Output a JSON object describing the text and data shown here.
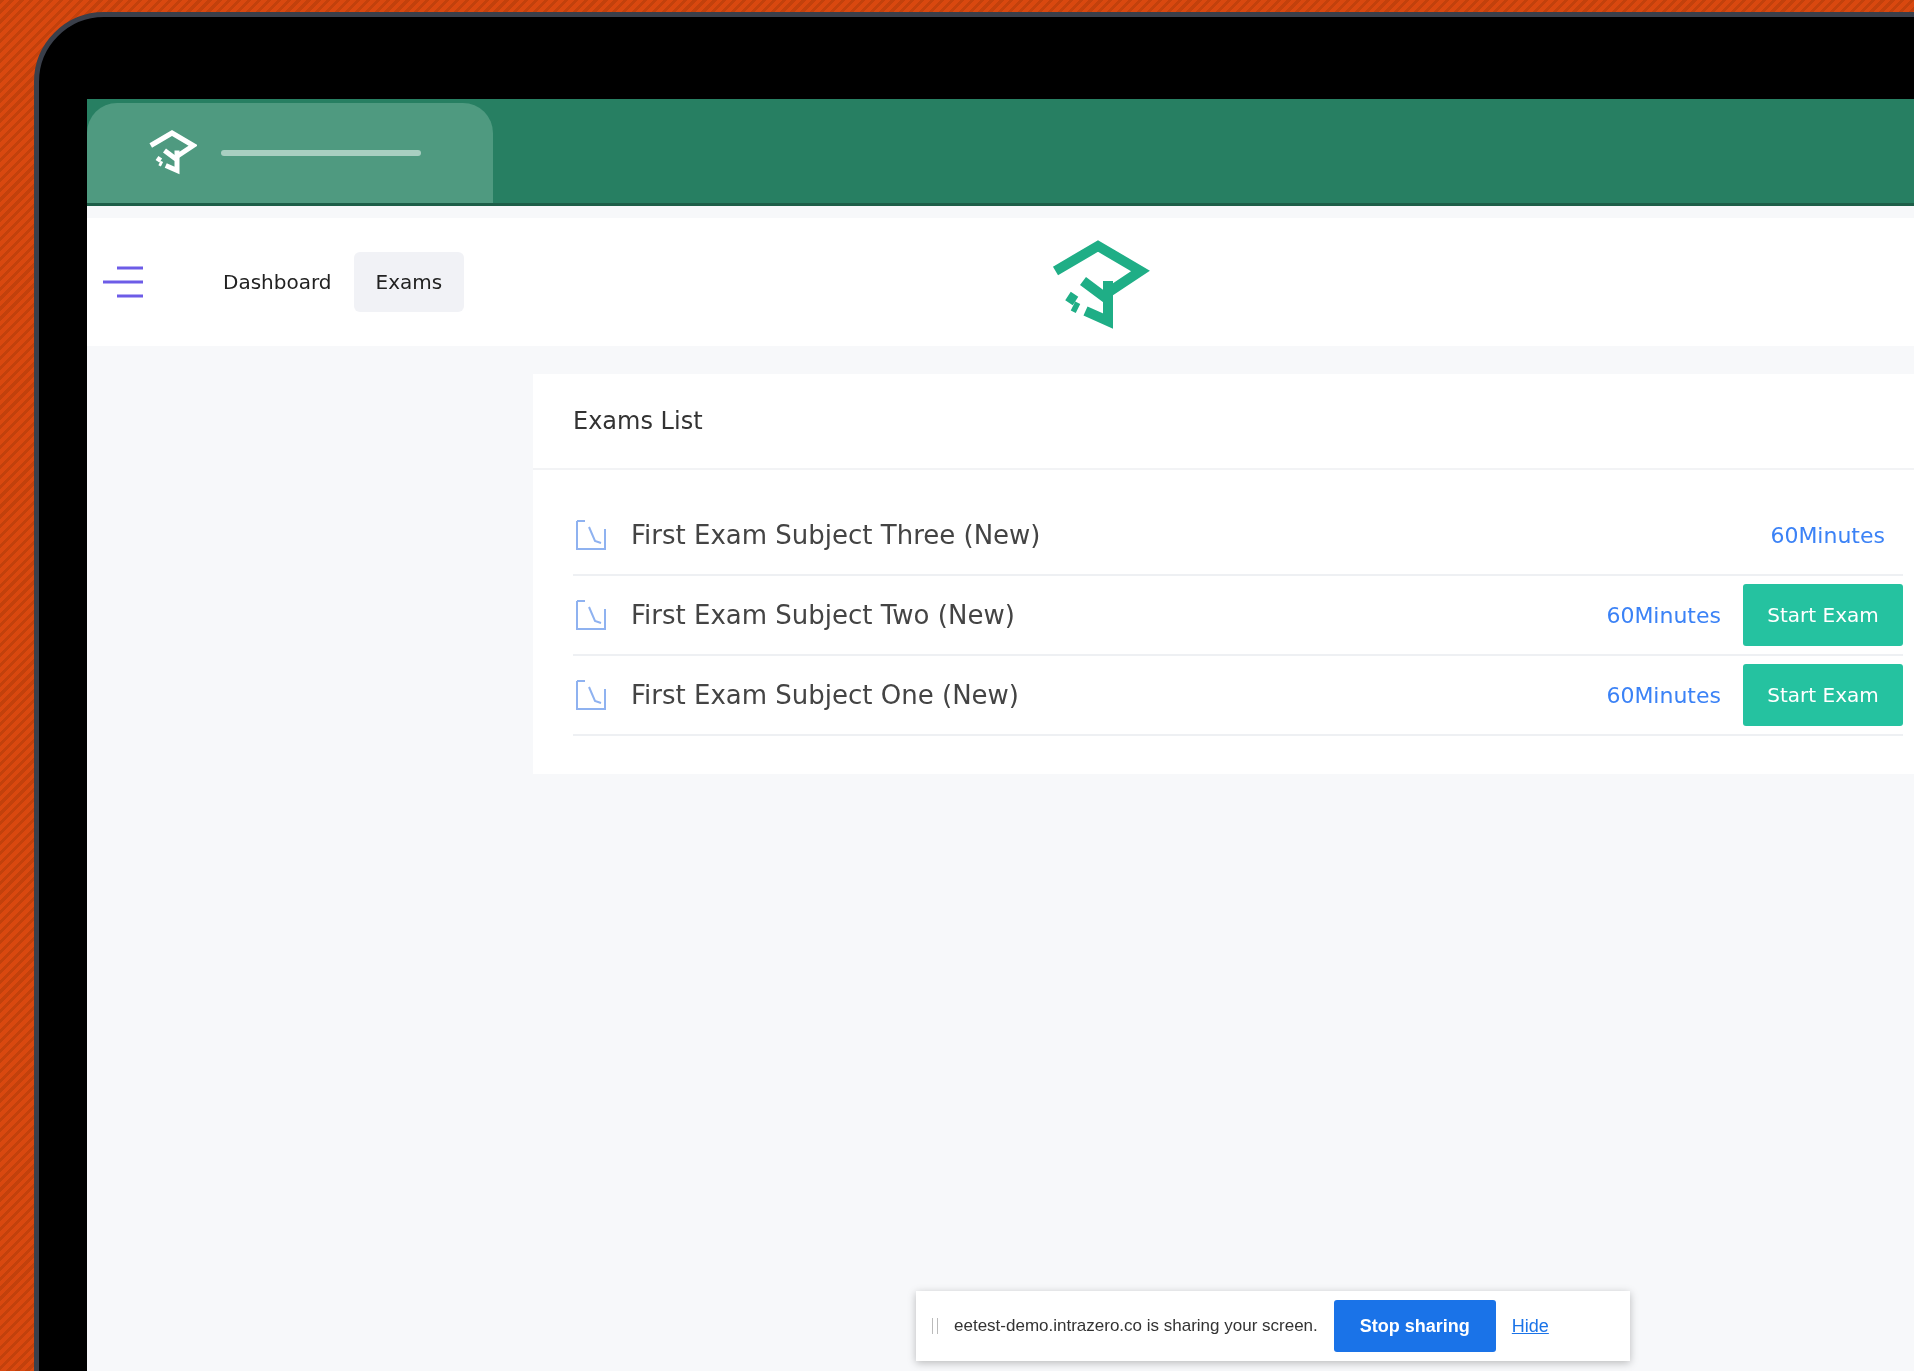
{
  "nav": {
    "items": [
      {
        "label": "Dashboard",
        "selected": false
      },
      {
        "label": "Exams",
        "selected": true
      }
    ]
  },
  "exams_card": {
    "title": "Exams List",
    "rows": [
      {
        "title": "First Exam Subject Three (New)",
        "duration": "60Minutes"
      },
      {
        "title": "First Exam Subject Two (New)",
        "duration": "60Minutes",
        "button": "Start Exam"
      },
      {
        "title": "First Exam Subject One (New)",
        "duration": "60Minutes",
        "button": "Start Exam"
      }
    ]
  },
  "share_bar": {
    "message": "eetest-demo.intrazero.co is sharing your screen.",
    "stop_button": "Stop sharing",
    "hide_link": "Hide"
  }
}
